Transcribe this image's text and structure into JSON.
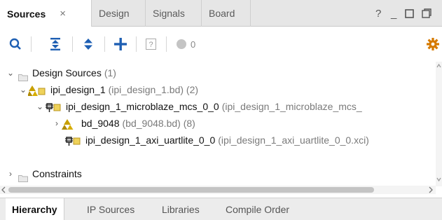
{
  "tabs": [
    {
      "label": "Sources",
      "active": true,
      "close": "×"
    },
    {
      "label": "Design"
    },
    {
      "label": "Signals"
    },
    {
      "label": "Board"
    }
  ],
  "window_controls": {
    "help": "?",
    "minimize": "_",
    "maximize": "☐",
    "float": "⧉"
  },
  "toolbar": {
    "icons": [
      "search-icon",
      "collapse-all-icon",
      "expand-all-icon",
      "add-icon",
      "info-icon",
      "status-dot-icon",
      "settings-icon"
    ],
    "status_count": "0"
  },
  "tree": {
    "rows": [
      {
        "name": "Design Sources",
        "detail": "(1)",
        "expanded": true,
        "icon": "folder-icon"
      },
      {
        "name": "ipi_design_1",
        "detail": "(ipi_design_1.bd) (2)",
        "expanded": true,
        "icon": "block-design-icon"
      },
      {
        "name": "ipi_design_1_microblaze_mcs_0_0",
        "detail": "(ipi_design_1_microblaze_mcs_",
        "expanded": true,
        "icon": "ip-icon"
      },
      {
        "name": "bd_9048",
        "detail": "(bd_9048.bd) (8)",
        "expanded": false,
        "icon": "block-design-icon"
      },
      {
        "name": "ipi_design_1_axi_uartlite_0_0",
        "detail": "(ipi_design_1_axi_uartlite_0_0.xci)",
        "icon": "ip-icon"
      },
      {
        "name": "Constraints",
        "detail": "",
        "expanded": false,
        "icon": "folder-icon"
      }
    ]
  },
  "bottom_tabs": [
    {
      "label": "Hierarchy",
      "active": true
    },
    {
      "label": "IP Sources"
    },
    {
      "label": "Libraries"
    },
    {
      "label": "Compile Order"
    }
  ],
  "colors": {
    "accent_blue": "#1e5fb3",
    "settings_orange": "#d67a00",
    "bd_yellow": "#c8a000"
  }
}
